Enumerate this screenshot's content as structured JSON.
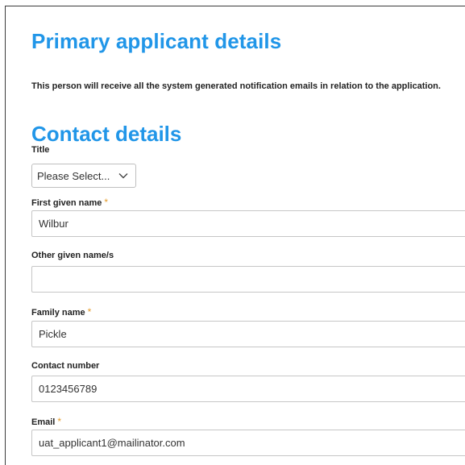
{
  "section": {
    "title": "Primary applicant details",
    "intro": "This person will receive all the system generated notification emails in relation to the application."
  },
  "contact": {
    "heading": "Contact details"
  },
  "fields": {
    "title": {
      "label": "Title",
      "value": "Please Select..."
    },
    "first_given_name": {
      "label": "First given name",
      "required_mark": "*",
      "value": "Wilbur"
    },
    "other_given_names": {
      "label": "Other given name/s",
      "value": ""
    },
    "family_name": {
      "label": "Family name",
      "required_mark": "*",
      "value": "Pickle"
    },
    "contact_number": {
      "label": "Contact number",
      "value": "0123456789"
    },
    "email": {
      "label": "Email",
      "required_mark": "*",
      "value": "uat_applicant1@mailinator.com"
    }
  },
  "colors": {
    "heading": "#2196e8",
    "required": "#e39b2b"
  }
}
